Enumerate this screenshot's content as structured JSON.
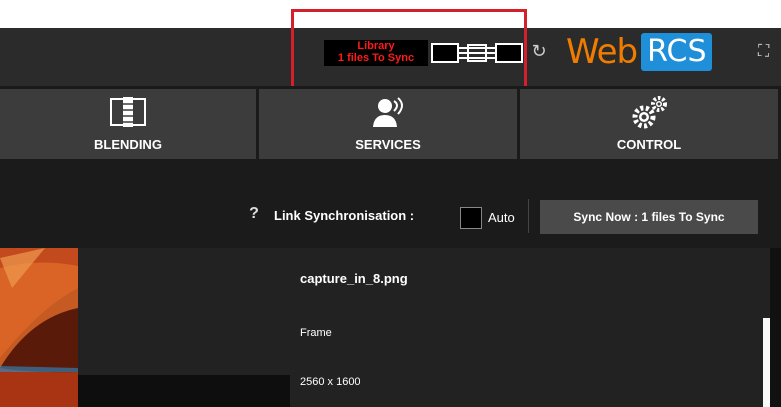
{
  "header": {
    "library_label": "Library",
    "files_to_sync_label": "1 files To Sync",
    "brand_web": "Web",
    "brand_rcs": "RCS",
    "status_color": "#ff1a1a",
    "brand_orange": "#f07d00",
    "brand_blue": "#1e8fd8",
    "icons": [
      "link-status-icon",
      "reload-icon",
      "fullscreen-icon"
    ]
  },
  "nav": {
    "tabs": [
      {
        "label": "BLENDING",
        "icon": "blending-icon"
      },
      {
        "label": "SERVICES",
        "icon": "services-icon"
      },
      {
        "label": "CONTROL",
        "icon": "control-gears-icon"
      }
    ]
  },
  "sync": {
    "help_symbol": "?",
    "link_label": "Link Synchronisation :",
    "auto_label": "Auto",
    "auto_checked": false,
    "sync_now_label": "Sync Now : 1 files To Sync"
  },
  "files": [
    {
      "name": "capture_in_8.png",
      "type": "Frame",
      "dimensions": "2560 x 1600"
    }
  ]
}
